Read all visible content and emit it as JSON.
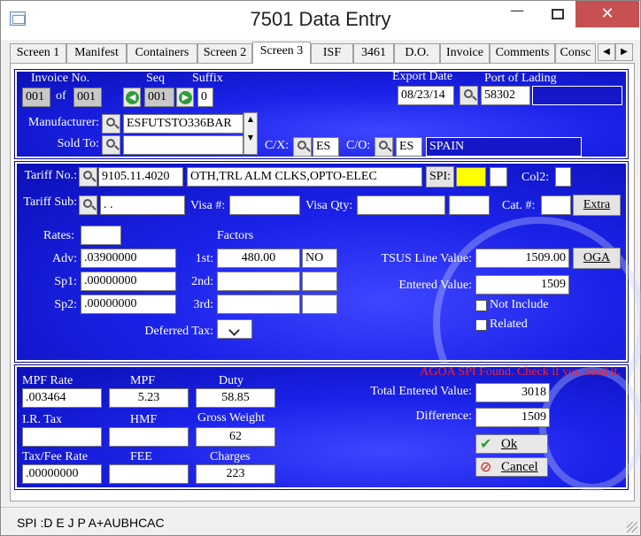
{
  "window": {
    "title": "7501 Data Entry"
  },
  "tabs": [
    "Screen 1",
    "Manifest",
    "Containers",
    "Screen 2",
    "Screen 3",
    "ISF",
    "3461",
    "D.O.",
    "Invoice",
    "Comments",
    "Consc"
  ],
  "active_tab": "Screen 3",
  "header": {
    "invoice_no_label": "Invoice No.",
    "invoice_no": "001",
    "of_label": "of",
    "invoice_total": "001",
    "seq_label": "Seq",
    "seq": "001",
    "suffix_label": "Suffix",
    "suffix": "0",
    "export_date_label": "Export Date",
    "export_date": "08/23/14",
    "port_label": "Port of Lading",
    "port_code": "58302",
    "port_name": "",
    "manufacturer_label": "Manufacturer:",
    "manufacturer": "ESFUTSTO336BAR",
    "sold_to_label": "Sold To:",
    "sold_to": "",
    "cx_label": "C/X:",
    "cx": "ES",
    "co_label": "C/O:",
    "co": "ES",
    "country": "SPAIN"
  },
  "tariff": {
    "tariff_no_label": "Tariff No.:",
    "tariff_no": "9105.11.4020",
    "description": "OTH,TRL ALM CLKS,OPTO-ELEC",
    "spi_label": "SPI:",
    "spi_value": "",
    "spi_extra": "",
    "col2_label": "Col2:",
    "col2": "",
    "tariff_sub_label": "Tariff Sub:",
    "tariff_sub": "  .  .",
    "visa_label": "Visa #:",
    "visa": "",
    "visa_qty_label": "Visa Qty:",
    "visa_qty": "",
    "visa_qty2": "",
    "cat_label": "Cat. #:",
    "cat": "",
    "extra_button": "Extra",
    "rates_label": "Rates:",
    "rates": "",
    "factors_label": "Factors",
    "adv_label": "Adv:",
    "adv": ".03900000",
    "sp1_label": "Sp1:",
    "sp1": ".00000000",
    "sp2_label": "Sp2:",
    "sp2": ".00000000",
    "first_label": "1st:",
    "first": "480.00",
    "first_unit": "NO",
    "second_label": "2nd:",
    "second": "",
    "second_unit": "",
    "third_label": "3rd:",
    "third": "",
    "third_unit": "",
    "deferred_tax_label": "Deferred Tax:",
    "tsus_label": "TSUS Line Value:",
    "tsus_value": "1509.00",
    "oga_button": "OGA",
    "entered_label": "Entered Value:",
    "entered_value": "1509",
    "not_include_label": "Not Include",
    "related_label": "Related"
  },
  "totals": {
    "agoa_message": "AGOA SPI Found. Check if you need it.",
    "mpf_rate_label": "MPF Rate",
    "mpf_rate": ".003464",
    "mpf_label": "MPF",
    "mpf": "5.23",
    "duty_label": "Duty",
    "duty": "58.85",
    "ir_tax_label": "I.R. Tax",
    "ir_tax": "",
    "hmf_label": "HMF",
    "hmf": "",
    "gross_weight_label": "Gross Weight",
    "gross_weight": "62",
    "tax_fee_rate_label": "Tax/Fee Rate",
    "tax_fee_rate": ".00000000",
    "fee_label": "FEE",
    "fee": "",
    "charges_label": "Charges",
    "charges": "223",
    "total_entered_label": "Total Entered Value:",
    "total_entered": "3018",
    "difference_label": "Difference:",
    "difference": "1509",
    "ok_button": "Ok",
    "cancel_button": "Cancel"
  },
  "status": {
    "text": "SPI :D E J P A+AUBHCAC"
  },
  "colors": {
    "panel_blue": "#1b22e8",
    "agoa_red": "#ff2020",
    "spi_yellow": "#ffff00",
    "close_red": "#c75050"
  }
}
